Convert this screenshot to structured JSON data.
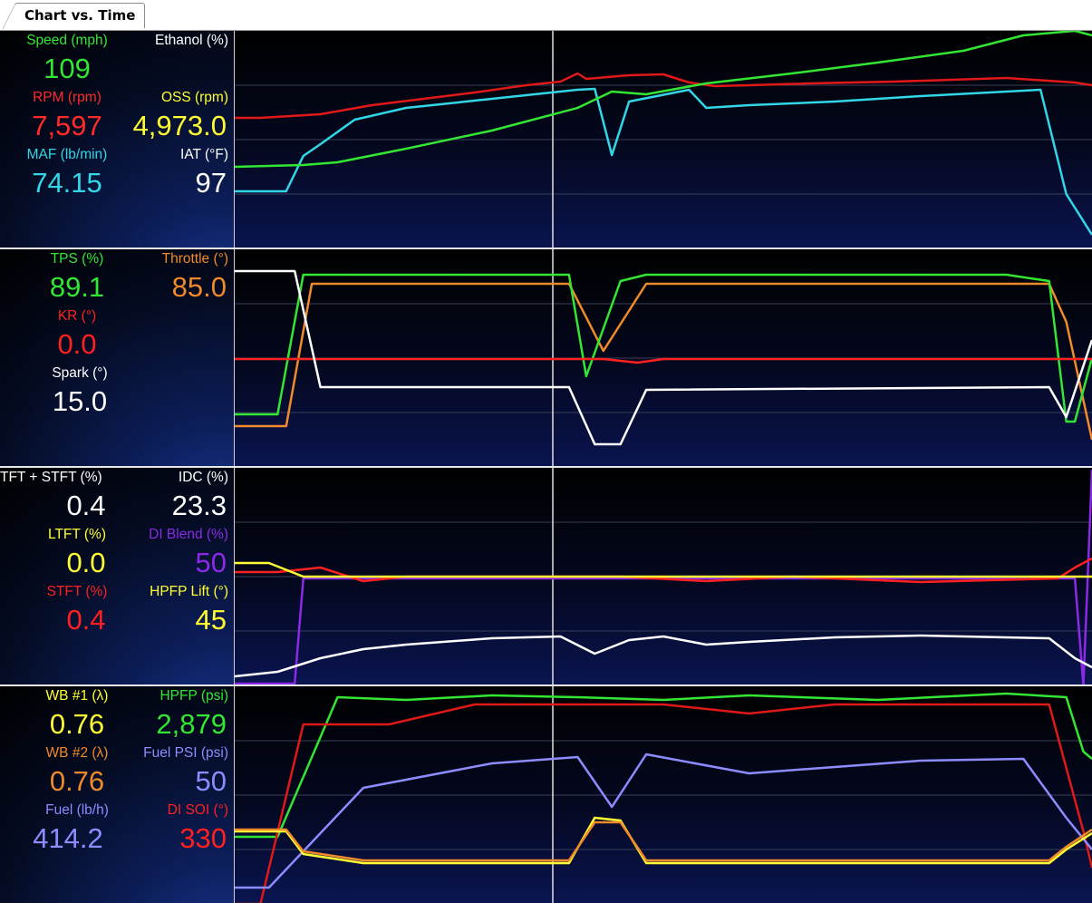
{
  "window": {
    "tab_label": "Chart vs. Time"
  },
  "panels": [
    {
      "id": "p1",
      "gauges": [
        {
          "name": "speed",
          "label": "Speed (mph)",
          "value": "109",
          "color": "#33e633"
        },
        {
          "name": "ethanol",
          "label": "Ethanol (%)",
          "value": "",
          "color": "#ffffff"
        },
        {
          "name": "rpm",
          "label": "RPM (rpm)",
          "value": "7,597",
          "color": "#ff2a2a"
        },
        {
          "name": "oss",
          "label": "OSS (rpm)",
          "value": "4,973.0",
          "color": "#ffff33"
        },
        {
          "name": "maf",
          "label": "MAF (lb/min)",
          "value": "74.15",
          "color": "#33d6e6"
        },
        {
          "name": "iat",
          "label": "IAT (°F)",
          "value": "97",
          "color": "#ffffff"
        }
      ]
    },
    {
      "id": "p2",
      "gauges": [
        {
          "name": "tps",
          "label": "TPS (%)",
          "value": "89.1",
          "color": "#33e633"
        },
        {
          "name": "throttle",
          "label": "Throttle (°)",
          "value": "85.0",
          "color": "#f08a2a"
        },
        {
          "name": "kr",
          "label": "KR (°)",
          "value": "0.0",
          "color": "#ff2020"
        },
        {
          "name": "spark",
          "label": "Spark (°)",
          "value": "15.0",
          "color": "#ffffff"
        }
      ]
    },
    {
      "id": "p3",
      "gauges": [
        {
          "name": "ltft-stft",
          "label": "TFT + STFT (%)",
          "value": "0.4",
          "color": "#ffffff"
        },
        {
          "name": "idc",
          "label": "IDC (%)",
          "value": "23.3",
          "color": "#ffffff"
        },
        {
          "name": "ltft",
          "label": "LTFT (%)",
          "value": "0.0",
          "color": "#ffff33"
        },
        {
          "name": "di-blend",
          "label": "DI Blend (%)",
          "value": "50",
          "color": "#8a2ae6"
        },
        {
          "name": "stft",
          "label": "STFT (%)",
          "value": "0.4",
          "color": "#ff2020"
        },
        {
          "name": "hpfp-lift",
          "label": "HPFP Lift (°)",
          "value": "45",
          "color": "#ffff33"
        }
      ]
    },
    {
      "id": "p4",
      "gauges": [
        {
          "name": "wb1",
          "label": "WB #1 (λ)",
          "value": "0.76",
          "color": "#ffff33"
        },
        {
          "name": "hpfp",
          "label": "HPFP (psi)",
          "value": "2,879",
          "color": "#33e633"
        },
        {
          "name": "wb2",
          "label": "WB #2 (λ)",
          "value": "0.76",
          "color": "#f08a2a"
        },
        {
          "name": "fuel-psi",
          "label": "Fuel PSI (psi)",
          "value": "50",
          "color": "#8c8cff"
        },
        {
          "name": "fuel",
          "label": "Fuel (lb/h)",
          "value": "414.2",
          "color": "#8c8cff"
        },
        {
          "name": "di-soi",
          "label": "DI SOI (°)",
          "value": "330",
          "color": "#ff2020"
        }
      ]
    }
  ],
  "chart_data": [
    {
      "type": "line",
      "panel": "p1",
      "series": [
        {
          "name": "RPM (rpm)",
          "color": "#e01818",
          "values": [
            [
              0,
              96
            ],
            [
              3,
              96
            ],
            [
              10,
              92
            ],
            [
              16,
              82
            ],
            [
              22,
              75
            ],
            [
              28,
              68
            ],
            [
              34,
              60
            ],
            [
              38,
              56
            ],
            [
              40,
              47
            ],
            [
              41,
              53
            ],
            [
              46,
              49
            ],
            [
              50,
              48
            ],
            [
              53,
              57
            ],
            [
              56,
              61
            ],
            [
              60,
              60
            ],
            [
              67,
              58
            ],
            [
              77,
              56
            ],
            [
              90,
              52
            ],
            [
              98,
              57
            ],
            [
              100,
              60
            ]
          ]
        },
        {
          "name": "MAF (lb/min)",
          "color": "#33d6e6",
          "values": [
            [
              0,
              177
            ],
            [
              6,
              177
            ],
            [
              8,
              138
            ],
            [
              10,
              125
            ],
            [
              14,
              98
            ],
            [
              20,
              85
            ],
            [
              30,
              75
            ],
            [
              40,
              65
            ],
            [
              42,
              64
            ],
            [
              44,
              137
            ],
            [
              46,
              78
            ],
            [
              53,
              65
            ],
            [
              55,
              85
            ],
            [
              60,
              82
            ],
            [
              70,
              78
            ],
            [
              80,
              72
            ],
            [
              94,
              65
            ],
            [
              97,
              180
            ],
            [
              100,
              225
            ]
          ]
        },
        {
          "name": "Speed (mph)",
          "color": "#33e633",
          "values": [
            [
              0,
              150
            ],
            [
              8,
              148
            ],
            [
              12,
              145
            ],
            [
              20,
              130
            ],
            [
              30,
              110
            ],
            [
              40,
              85
            ],
            [
              44,
              67
            ],
            [
              48,
              70
            ],
            [
              55,
              58
            ],
            [
              65,
              47
            ],
            [
              75,
              35
            ],
            [
              85,
              22
            ],
            [
              92,
              5
            ],
            [
              98,
              0
            ],
            [
              100,
              5
            ]
          ]
        }
      ]
    },
    {
      "type": "line",
      "panel": "p2",
      "series": [
        {
          "name": "Throttle (°)",
          "color": "#f08a2a",
          "values": [
            [
              0,
              195
            ],
            [
              6,
              195
            ],
            [
              9,
              38
            ],
            [
              39,
              38
            ],
            [
              43,
              112
            ],
            [
              48,
              38
            ],
            [
              95,
              38
            ],
            [
              97,
              80
            ],
            [
              100,
              210
            ]
          ]
        },
        {
          "name": "TPS (%)",
          "color": "#33e633",
          "values": [
            [
              0,
              182
            ],
            [
              5,
              182
            ],
            [
              8,
              28
            ],
            [
              39,
              28
            ],
            [
              41,
              140
            ],
            [
              45,
              35
            ],
            [
              48,
              28
            ],
            [
              90,
              28
            ],
            [
              95,
              35
            ],
            [
              97,
              190
            ],
            [
              98,
              190
            ],
            [
              100,
              120
            ]
          ]
        },
        {
          "name": "KR (°)",
          "color": "#ff2020",
          "values": [
            [
              0,
              121
            ],
            [
              43,
              121
            ],
            [
              47,
              125
            ],
            [
              50,
              121
            ],
            [
              100,
              121
            ]
          ]
        },
        {
          "name": "Spark (°)",
          "color": "#ffffff",
          "values": [
            [
              0,
              24
            ],
            [
              7,
              24
            ],
            [
              10,
              152
            ],
            [
              39,
              152
            ],
            [
              42,
              215
            ],
            [
              45,
              215
            ],
            [
              48,
              155
            ],
            [
              95,
              152
            ],
            [
              97,
              185
            ],
            [
              100,
              100
            ]
          ]
        }
      ]
    },
    {
      "type": "line",
      "panel": "p3",
      "series": [
        {
          "name": "DI Blend (%)",
          "color": "#8a2ae6",
          "values": [
            [
              0,
              238
            ],
            [
              7,
              238
            ],
            [
              8,
              122
            ],
            [
              98,
              122
            ],
            [
              99,
              240
            ],
            [
              100,
              2
            ]
          ]
        },
        {
          "name": "TFT + STFT (%)",
          "color": "#ffffff",
          "values": [
            [
              0,
              230
            ],
            [
              5,
              225
            ],
            [
              10,
              210
            ],
            [
              15,
              200
            ],
            [
              20,
              195
            ],
            [
              30,
              188
            ],
            [
              38,
              186
            ],
            [
              42,
              205
            ],
            [
              46,
              190
            ],
            [
              50,
              186
            ],
            [
              55,
              195
            ],
            [
              60,
              192
            ],
            [
              70,
              187
            ],
            [
              80,
              185
            ],
            [
              95,
              188
            ],
            [
              98,
              210
            ],
            [
              100,
              220
            ]
          ]
        },
        {
          "name": "STFT (%)",
          "color": "#ff2020",
          "values": [
            [
              0,
              115
            ],
            [
              5,
              115
            ],
            [
              10,
              110
            ],
            [
              15,
              125
            ],
            [
              20,
              120
            ],
            [
              30,
              120
            ],
            [
              45,
              120
            ],
            [
              55,
              125
            ],
            [
              65,
              120
            ],
            [
              80,
              126
            ],
            [
              96,
              122
            ],
            [
              98,
              110
            ],
            [
              100,
              100
            ]
          ]
        },
        {
          "name": "LTFT (%)",
          "color": "#ffff33",
          "values": [
            [
              0,
              105
            ],
            [
              4,
              105
            ],
            [
              8,
              120
            ],
            [
              100,
              120
            ]
          ]
        }
      ]
    },
    {
      "type": "line",
      "panel": "p4",
      "series": [
        {
          "name": "HPFP (psi)",
          "color": "#33e633",
          "values": [
            [
              0,
              166
            ],
            [
              5,
              166
            ],
            [
              12,
              12
            ],
            [
              20,
              15
            ],
            [
              30,
              10
            ],
            [
              40,
              12
            ],
            [
              50,
              15
            ],
            [
              60,
              10
            ],
            [
              75,
              15
            ],
            [
              90,
              8
            ],
            [
              97,
              12
            ],
            [
              99,
              72
            ],
            [
              100,
              80
            ]
          ]
        },
        {
          "name": "DI SOI (°)",
          "color": "#e01818",
          "values": [
            [
              0,
              240
            ],
            [
              3,
              240
            ],
            [
              8,
              42
            ],
            [
              18,
              42
            ],
            [
              28,
              20
            ],
            [
              50,
              20
            ],
            [
              60,
              30
            ],
            [
              70,
              20
            ],
            [
              95,
              20
            ],
            [
              99,
              160
            ],
            [
              100,
              200
            ]
          ]
        },
        {
          "name": "Fuel PSI (psi)",
          "color": "#8c8cff",
          "values": [
            [
              0,
              222
            ],
            [
              4,
              222
            ],
            [
              15,
              112
            ],
            [
              30,
              85
            ],
            [
              40,
              78
            ],
            [
              44,
              133
            ],
            [
              48,
              75
            ],
            [
              60,
              96
            ],
            [
              80,
              82
            ],
            [
              92,
              80
            ],
            [
              97,
              145
            ],
            [
              100,
              180
            ]
          ]
        },
        {
          "name": "WB #1 (λ)",
          "color": "#ffff33",
          "values": [
            [
              0,
              160
            ],
            [
              6,
              160
            ],
            [
              8,
              185
            ],
            [
              15,
              195
            ],
            [
              30,
              195
            ],
            [
              39,
              195
            ],
            [
              42,
              145
            ],
            [
              45,
              148
            ],
            [
              48,
              195
            ],
            [
              95,
              195
            ],
            [
              97,
              180
            ],
            [
              100,
              162
            ]
          ]
        },
        {
          "name": "WB #2 (λ)",
          "color": "#f08a2a",
          "values": [
            [
              0,
              158
            ],
            [
              6,
              158
            ],
            [
              8,
              182
            ],
            [
              15,
              192
            ],
            [
              30,
              192
            ],
            [
              39,
              192
            ],
            [
              42,
              150
            ],
            [
              45,
              150
            ],
            [
              48,
              192
            ],
            [
              95,
              192
            ],
            [
              97,
              177
            ],
            [
              100,
              158
            ]
          ]
        }
      ]
    }
  ]
}
